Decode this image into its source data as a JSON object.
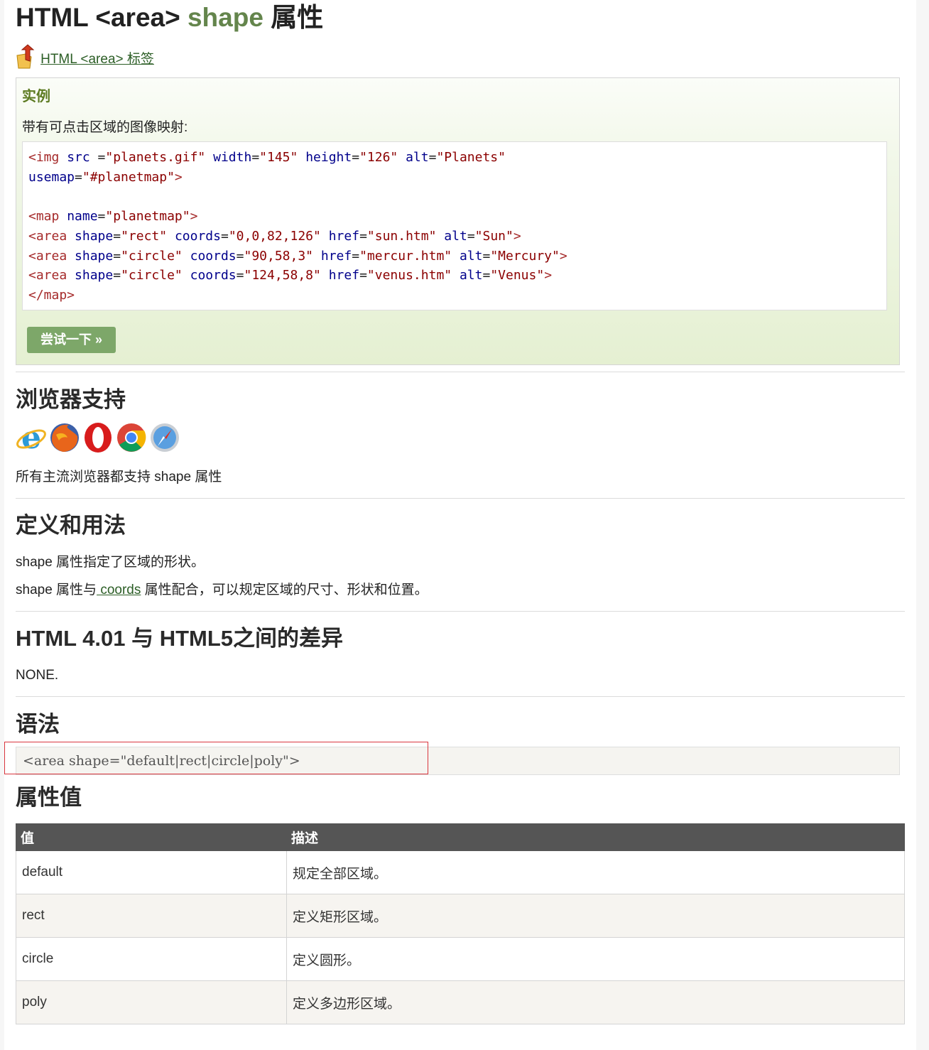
{
  "page": {
    "title_parts": [
      "HTML <area> ",
      "shape",
      " 属性"
    ],
    "back_link": "HTML <area> 标签"
  },
  "example": {
    "heading": "实例",
    "intro": "带有可点击区域的图像映射:",
    "code_lines": [
      [
        [
          "tag",
          "<img "
        ],
        [
          "attr",
          "src "
        ],
        [
          "eq",
          "="
        ],
        [
          "val",
          "\"planets.gif\""
        ],
        [
          "eq",
          " "
        ],
        [
          "attr",
          "width"
        ],
        [
          "eq",
          "="
        ],
        [
          "val",
          "\"145\""
        ],
        [
          "eq",
          " "
        ],
        [
          "attr",
          "height"
        ],
        [
          "eq",
          "="
        ],
        [
          "val",
          "\"126\""
        ],
        [
          "eq",
          " "
        ],
        [
          "attr",
          "alt"
        ],
        [
          "eq",
          "="
        ],
        [
          "val",
          "\"Planets\""
        ]
      ],
      [
        [
          "attr",
          "usemap"
        ],
        [
          "eq",
          "="
        ],
        [
          "val",
          "\"#planetmap\""
        ],
        [
          "tag",
          ">"
        ]
      ],
      [],
      [
        [
          "tag",
          "<map "
        ],
        [
          "attr",
          "name"
        ],
        [
          "eq",
          "="
        ],
        [
          "val",
          "\"planetmap\""
        ],
        [
          "tag",
          ">"
        ]
      ],
      [
        [
          "tag",
          "<area "
        ],
        [
          "attr",
          "shape"
        ],
        [
          "eq",
          "="
        ],
        [
          "val",
          "\"rect\""
        ],
        [
          "eq",
          " "
        ],
        [
          "attr",
          "coords"
        ],
        [
          "eq",
          "="
        ],
        [
          "val",
          "\"0,0,82,126\""
        ],
        [
          "eq",
          " "
        ],
        [
          "attr",
          "href"
        ],
        [
          "eq",
          "="
        ],
        [
          "val",
          "\"sun.htm\""
        ],
        [
          "eq",
          " "
        ],
        [
          "attr",
          "alt"
        ],
        [
          "eq",
          "="
        ],
        [
          "val",
          "\"Sun\""
        ],
        [
          "tag",
          ">"
        ]
      ],
      [
        [
          "tag",
          "<area "
        ],
        [
          "attr",
          "shape"
        ],
        [
          "eq",
          "="
        ],
        [
          "val",
          "\"circle\""
        ],
        [
          "eq",
          " "
        ],
        [
          "attr",
          "coords"
        ],
        [
          "eq",
          "="
        ],
        [
          "val",
          "\"90,58,3\""
        ],
        [
          "eq",
          " "
        ],
        [
          "attr",
          "href"
        ],
        [
          "eq",
          "="
        ],
        [
          "val",
          "\"mercur.htm\""
        ],
        [
          "eq",
          " "
        ],
        [
          "attr",
          "alt"
        ],
        [
          "eq",
          "="
        ],
        [
          "val",
          "\"Mercury\""
        ],
        [
          "tag",
          ">"
        ]
      ],
      [
        [
          "tag",
          "<area "
        ],
        [
          "attr",
          "shape"
        ],
        [
          "eq",
          "="
        ],
        [
          "val",
          "\"circle\""
        ],
        [
          "eq",
          " "
        ],
        [
          "attr",
          "coords"
        ],
        [
          "eq",
          "="
        ],
        [
          "val",
          "\"124,58,8\""
        ],
        [
          "eq",
          " "
        ],
        [
          "attr",
          "href"
        ],
        [
          "eq",
          "="
        ],
        [
          "val",
          "\"venus.htm\""
        ],
        [
          "eq",
          " "
        ],
        [
          "attr",
          "alt"
        ],
        [
          "eq",
          "="
        ],
        [
          "val",
          "\"Venus\""
        ],
        [
          "tag",
          ">"
        ]
      ],
      [
        [
          "tag",
          "</map>"
        ]
      ]
    ],
    "try_button": "尝试一下 »"
  },
  "browser_support": {
    "heading": "浏览器支持",
    "icons": [
      "internet-explorer-icon",
      "firefox-icon",
      "opera-icon",
      "chrome-icon",
      "safari-icon"
    ],
    "text": "所有主流浏览器都支持 shape 属性"
  },
  "definition": {
    "heading": "定义和用法",
    "line1": "shape 属性指定了区域的形状。",
    "line2_before": "shape 属性与",
    "line2_link": " coords",
    "line2_after": " 属性配合，可以规定区域的尺寸、形状和位置。"
  },
  "differences": {
    "heading": "HTML 4.01 与 HTML5之间的差异",
    "text": "NONE."
  },
  "syntax": {
    "heading": "语法",
    "code": "<area shape=\"default|rect|circle|poly\">"
  },
  "values": {
    "heading": "属性值",
    "columns": [
      "值",
      "描述"
    ],
    "rows": [
      [
        "default",
        "规定全部区域。"
      ],
      [
        "rect",
        "定义矩形区域。"
      ],
      [
        "circle",
        "定义圆形。"
      ],
      [
        "poly",
        "定义多边形区域。"
      ]
    ]
  },
  "colors": {
    "accent_green": "#64854c",
    "link_green": "#2c5e26",
    "button_green": "#7da769",
    "table_header": "#555555",
    "highlight_red": "#d9363e"
  }
}
